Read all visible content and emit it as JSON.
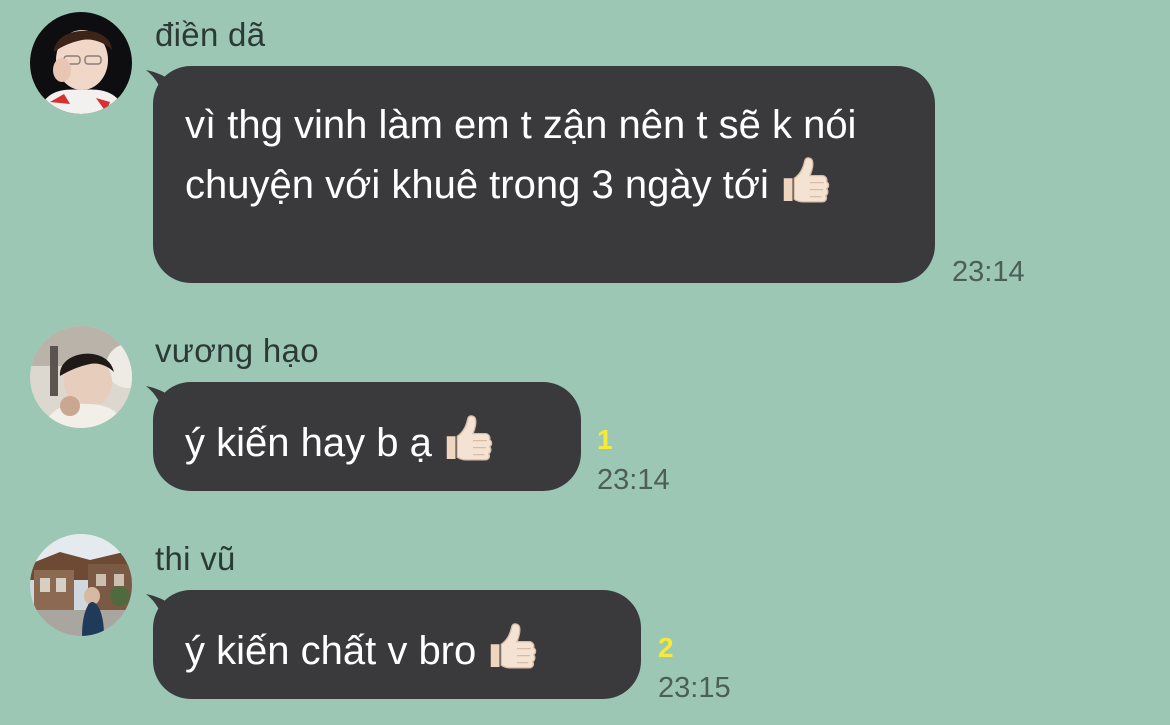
{
  "messages": [
    {
      "sender": "điền dã",
      "text": "vì thg vinh làm em t zận nên t sẽ k nói chuyện với khuê trong 3 ngày tới",
      "emoji": "thumbs-up",
      "time": "23:14",
      "read_count": ""
    },
    {
      "sender": "vương hạo",
      "text": "ý kiến hay b ạ",
      "emoji": "thumbs-up",
      "time": "23:14",
      "read_count": "1"
    },
    {
      "sender": "thi vũ",
      "text": "ý kiến chất v bro",
      "emoji": "thumbs-up",
      "time": "23:15",
      "read_count": "2"
    }
  ],
  "colors": {
    "background": "#9cc7b5",
    "bubble": "#3a3a3c",
    "bubble_text": "#ffffff",
    "time_text": "#4d5e58",
    "read_count": "#f5e93a"
  }
}
